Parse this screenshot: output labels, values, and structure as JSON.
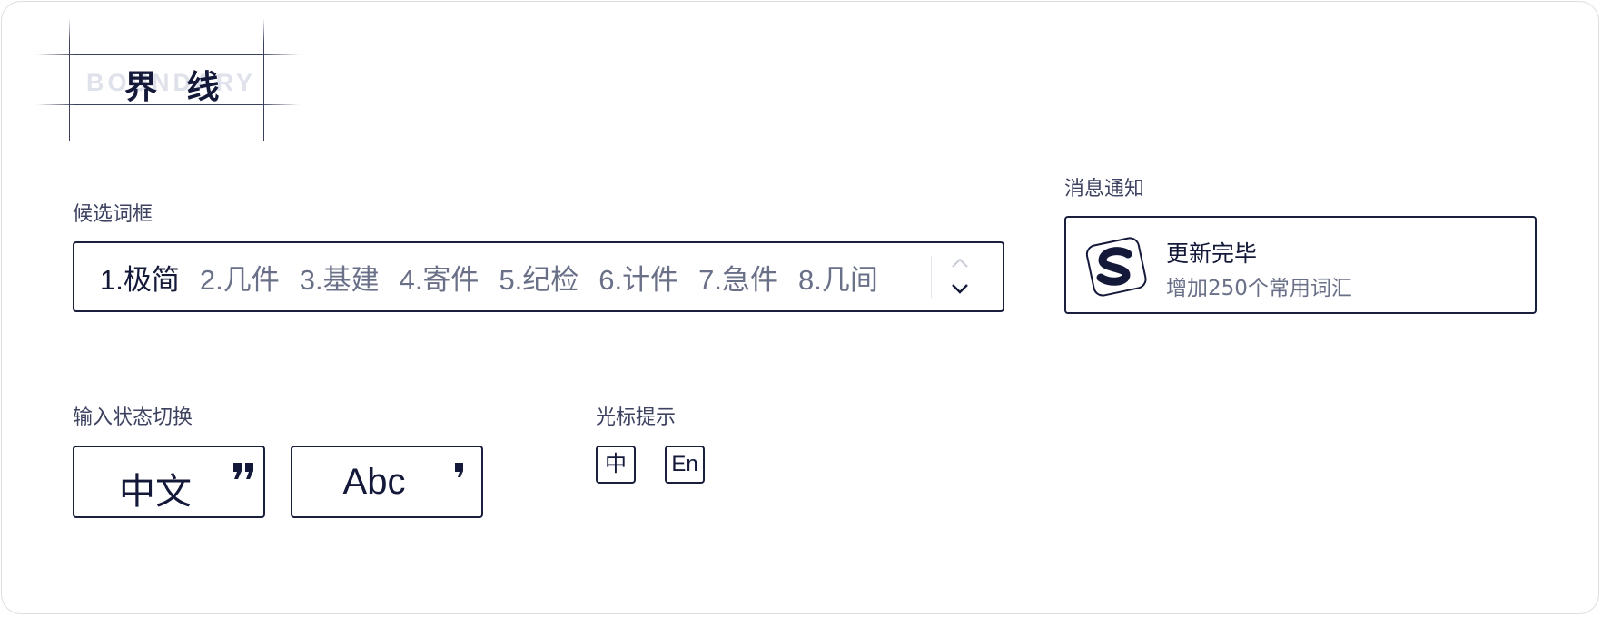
{
  "logo": {
    "brand": "界 线",
    "watermark": "BOUNDARY"
  },
  "candidates": {
    "section_label": "候选词框",
    "items": [
      "1.极简",
      "2.几件",
      "3.基建",
      "4.寄件",
      "5.纪检",
      "6.计件",
      "7.急件",
      "8.几间"
    ],
    "selected_index": 0
  },
  "notification": {
    "section_label": "消息通知",
    "title": "更新完毕",
    "message": "增加250个常用词汇",
    "icon": "sogou-s-logo-icon"
  },
  "input_state": {
    "section_label": "输入状态切换",
    "chinese_label": "中文",
    "english_label": "Abc"
  },
  "cursor_hint": {
    "section_label": "光标提示",
    "chinese_badge": "中",
    "english_badge": "En"
  },
  "colors": {
    "ink": "#14193a",
    "muted": "#6a7088",
    "border": "#1a1f3d"
  }
}
